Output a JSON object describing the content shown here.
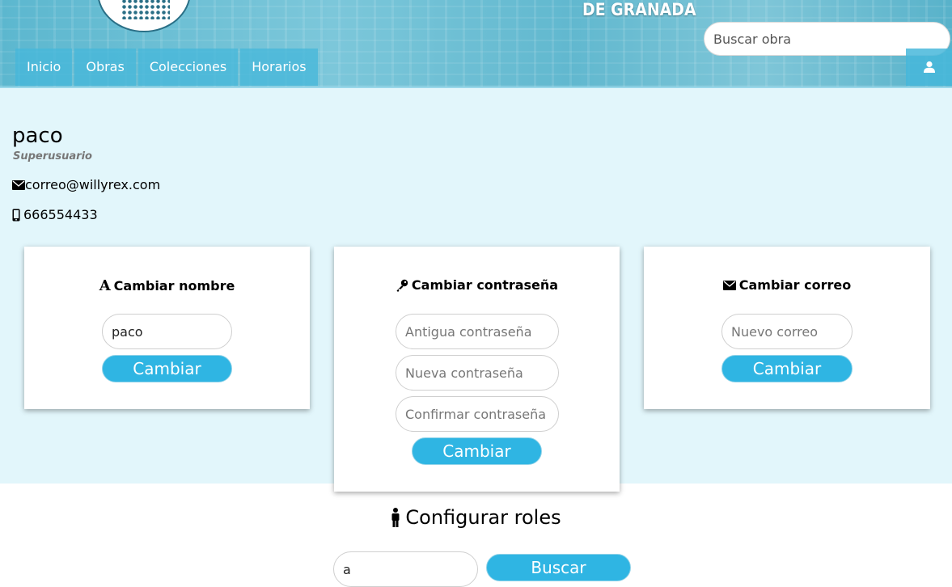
{
  "header": {
    "brand_line": "DE GRANADA",
    "search_placeholder": "Buscar obra",
    "nav": [
      "Inicio",
      "Obras",
      "Colecciones",
      "Horarios"
    ],
    "user_icon": "user-icon"
  },
  "profile": {
    "username": "paco",
    "role": "Superusuario",
    "email": "correo@willyrex.com",
    "phone": "666554433"
  },
  "cards": {
    "name": {
      "title": "Cambiar nombre",
      "icon": "font-icon",
      "value": "paco",
      "button": "Cambiar"
    },
    "password": {
      "title": "Cambiar contraseña",
      "icon": "key-icon",
      "placeholders": [
        "Antigua contraseña",
        "Nueva contraseña",
        "Confirmar contraseña"
      ],
      "button": "Cambiar"
    },
    "email": {
      "title": "Cambiar correo",
      "icon": "envelope-icon",
      "placeholder": "Nuevo correo",
      "button": "Cambiar"
    }
  },
  "roles": {
    "title": "Configurar roles",
    "icon": "person-icon",
    "search_value": "a",
    "button": "Buscar"
  },
  "colors": {
    "accent": "#2fb5e3",
    "profile_bg": "#e2f6fb",
    "nav_bg": "#47b7da"
  }
}
